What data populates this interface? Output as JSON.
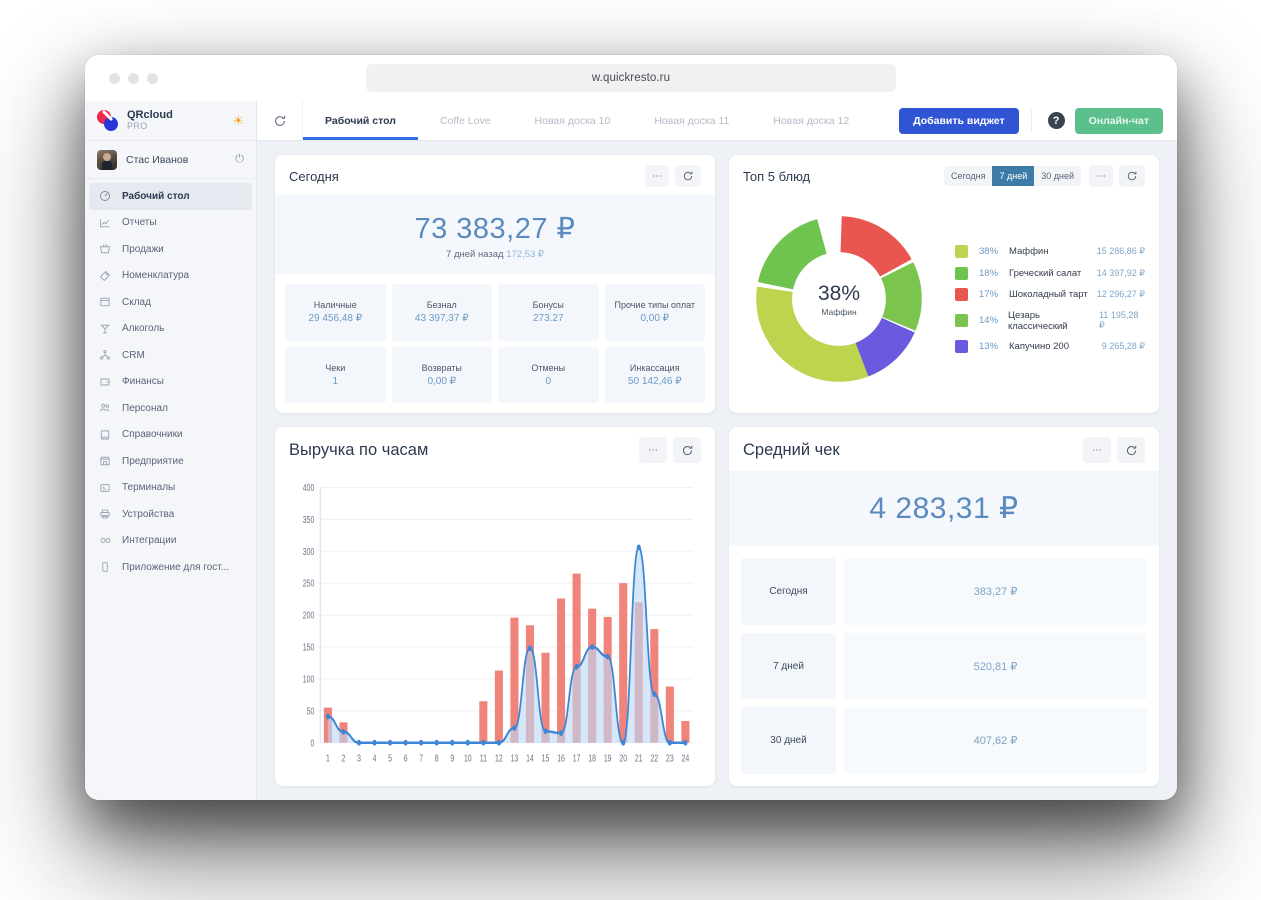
{
  "browser": {
    "url": "w.quickresto.ru"
  },
  "sidebar": {
    "brand": {
      "name": "QRcloud",
      "sub": "PRO",
      "theme_icon": "sun-icon"
    },
    "user": {
      "name": "Стас Иванов",
      "logout_icon": "power-icon"
    },
    "items": [
      {
        "label": "Рабочий стол",
        "icon": "dashboard-icon",
        "active": true
      },
      {
        "label": "Отчеты",
        "icon": "chart-icon",
        "active": false
      },
      {
        "label": "Продажи",
        "icon": "basket-icon",
        "active": false
      },
      {
        "label": "Номенклатура",
        "icon": "tag-icon",
        "active": false
      },
      {
        "label": "Склад",
        "icon": "box-icon",
        "active": false
      },
      {
        "label": "Алкоголь",
        "icon": "cocktail-icon",
        "active": false
      },
      {
        "label": "CRM",
        "icon": "network-icon",
        "active": false
      },
      {
        "label": "Финансы",
        "icon": "wallet-icon",
        "active": false
      },
      {
        "label": "Персонал",
        "icon": "people-icon",
        "active": false
      },
      {
        "label": "Справочники",
        "icon": "book-icon",
        "active": false
      },
      {
        "label": "Предприятие",
        "icon": "shop-icon",
        "active": false
      },
      {
        "label": "Терминалы",
        "icon": "terminal-icon",
        "active": false
      },
      {
        "label": "Устройства",
        "icon": "printer-icon",
        "active": false
      },
      {
        "label": "Интеграции",
        "icon": "infinity-icon",
        "active": false
      },
      {
        "label": "Приложение для гост...",
        "icon": "phone-icon",
        "active": false
      }
    ]
  },
  "topbar": {
    "refresh_icon": "refresh-icon",
    "tabs": [
      {
        "label": "Рабочий стол",
        "active": true
      },
      {
        "label": "Coffe Love",
        "active": false
      },
      {
        "label": "Новая доска 10",
        "active": false
      },
      {
        "label": "Новая доска 11",
        "active": false
      },
      {
        "label": "Новая доска 12",
        "active": false
      }
    ],
    "add_widget": "Добавить виджет",
    "help": "?",
    "chat": "Онлайн-чат"
  },
  "today": {
    "title": "Сегодня",
    "menu_icon": "ellipsis-icon",
    "refresh_icon": "refresh-icon",
    "total": "73 383,27 ₽",
    "compare_label": "7 дней назад",
    "compare_value": "172,53 ₽",
    "tiles": [
      {
        "key": "Наличные",
        "value": "29 456,48 ₽"
      },
      {
        "key": "Безнал",
        "value": "43 397,37 ₽"
      },
      {
        "key": "Бонусы",
        "value": "273.27"
      },
      {
        "key": "Прочие типы оплат",
        "value": "0,00 ₽"
      },
      {
        "key": "Чеки",
        "value": "1"
      },
      {
        "key": "Возвраты",
        "value": "0,00 ₽"
      },
      {
        "key": "Отмены",
        "value": "0"
      },
      {
        "key": "Инкассация",
        "value": "50 142,46 ₽"
      }
    ]
  },
  "top5": {
    "title": "Топ 5 блюд",
    "periods": [
      {
        "label": "Сегодня",
        "active": false
      },
      {
        "label": "7 дней",
        "active": true
      },
      {
        "label": "30 дней",
        "active": false
      }
    ],
    "menu_icon": "ellipsis-icon",
    "refresh_icon": "refresh-icon",
    "center_pct": "38%",
    "center_label": "Маффин",
    "chart_data": {
      "type": "pie",
      "title": "Топ 5 блюд",
      "legend_position": "right",
      "categories": [
        "Маффин",
        "Греческий салат",
        "Шоколадный тарт",
        "Цезарь классический",
        "Капучино 200"
      ],
      "values": [
        38,
        18,
        17,
        14,
        13
      ],
      "labels_pct": [
        "38%",
        "18%",
        "17%",
        "14%",
        "13%"
      ],
      "amounts": [
        "15 286,86 ₽",
        "14 397,92 ₽",
        "12 296,27 ₽",
        "11 195,28 ₽",
        "9 265,28 ₽"
      ],
      "colors": [
        "#bcd44e",
        "#6ec martinez",
        "#e8564f",
        "#6ec44e",
        "#6a5ae0"
      ]
    },
    "legend": [
      {
        "pct": "38%",
        "name": "Маффин",
        "value": "15 286,86 ₽",
        "color": "#bcd44e"
      },
      {
        "pct": "18%",
        "name": "Греческий салат",
        "value": "14 397,92 ₽",
        "color": "#6ec44e"
      },
      {
        "pct": "17%",
        "name": "Шоколадный тарт",
        "value": "12 296,27 ₽",
        "color": "#e8564f"
      },
      {
        "pct": "14%",
        "name": "Цезарь классический",
        "value": "11 195,28 ₽",
        "color": "#6ec44e"
      },
      {
        "pct": "13%",
        "name": "Капучино 200",
        "value": "9 265,28 ₽",
        "color": "#6a5ae0"
      }
    ]
  },
  "revenue": {
    "title": "Выручка по часам",
    "menu_icon": "ellipsis-icon",
    "refresh_icon": "refresh-icon",
    "chart_data": {
      "type": "bar",
      "title": "Выручка по часам",
      "xlabel": "",
      "ylabel": "",
      "ylim": [
        0,
        400
      ],
      "yticks": [
        0,
        50,
        100,
        150,
        200,
        250,
        300,
        350,
        400
      ],
      "grid": true,
      "categories": [
        "1",
        "2",
        "3",
        "4",
        "5",
        "6",
        "7",
        "8",
        "9",
        "10",
        "11",
        "12",
        "13",
        "14",
        "15",
        "16",
        "17",
        "18",
        "19",
        "20",
        "21",
        "22",
        "23",
        "24"
      ],
      "series": [
        {
          "name": "bars",
          "type": "bar",
          "color": "#ef6f63",
          "values": [
            55,
            32,
            0,
            0,
            0,
            0,
            0,
            0,
            0,
            0,
            65,
            113,
            196,
            184,
            141,
            226,
            265,
            210,
            197,
            250,
            220,
            178,
            88,
            34
          ]
        },
        {
          "name": "line",
          "type": "line",
          "color": "#3d86d6",
          "values": [
            41,
            17,
            0,
            0,
            0,
            0,
            0,
            0,
            0,
            0,
            0,
            0,
            23,
            148,
            18,
            15,
            119,
            150,
            135,
            0,
            306,
            76,
            0,
            0
          ]
        }
      ]
    }
  },
  "avg_check": {
    "title": "Средний чек",
    "menu_icon": "ellipsis-icon",
    "refresh_icon": "refresh-icon",
    "total": "4 283,31 ₽",
    "rows": [
      {
        "key": "Сегодня",
        "value": "383,27 ₽"
      },
      {
        "key": "7 дней",
        "value": "520,81 ₽"
      },
      {
        "key": "30 дней",
        "value": "407,62 ₽"
      }
    ]
  }
}
